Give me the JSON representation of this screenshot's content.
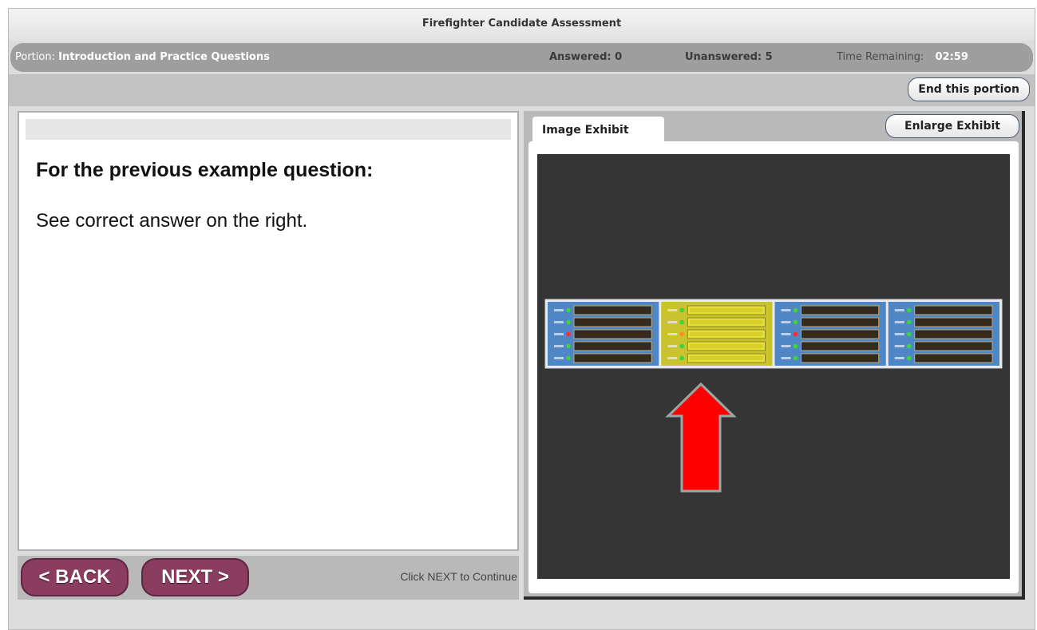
{
  "app": {
    "title": "Firefighter Candidate Assessment"
  },
  "status": {
    "portion_label": "Portion:",
    "portion_value": "Introduction and Practice Questions",
    "answered": "Answered: 0",
    "unanswered": "Unanswered: 5",
    "time_label": "Time Remaining:",
    "time_value": "02:59"
  },
  "toolbar": {
    "end_label": "End this portion"
  },
  "question": {
    "heading": "For the previous example question:",
    "text": "See correct answer on the right."
  },
  "nav": {
    "back_label": "< BACK",
    "next_label": "NEXT >",
    "hint": "Click NEXT to Continue"
  },
  "exhibit": {
    "tab_label": "Image Exhibit",
    "enlarge_label": "Enlarge Exhibit"
  },
  "panel_display": {
    "highlighted_column": 2,
    "columns": [
      {
        "color": "#4f86c6",
        "leds": [
          "green",
          "green",
          "red",
          "green",
          "green"
        ]
      },
      {
        "color": "#c9c42e",
        "leds": [
          "green",
          "green",
          "orange",
          "green",
          "green"
        ]
      },
      {
        "color": "#4f86c6",
        "leds": [
          "green",
          "green",
          "red",
          "green",
          "green"
        ]
      },
      {
        "color": "#4f86c6",
        "leds": [
          "green",
          "green",
          "green",
          "green",
          "green"
        ]
      }
    ]
  },
  "colors": {
    "nav_button": "#8a3d5e",
    "arrow": "#ff0000",
    "exhibit_bg": "#353535"
  }
}
